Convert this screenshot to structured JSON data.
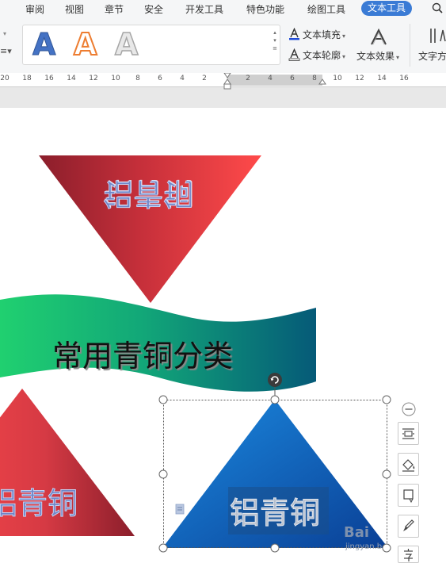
{
  "menubar": {
    "items": [
      {
        "label": "审阅"
      },
      {
        "label": "视图"
      },
      {
        "label": "章节"
      },
      {
        "label": "安全"
      },
      {
        "label": "开发工具"
      },
      {
        "label": "特色功能"
      },
      {
        "label": "绘图工具"
      },
      {
        "label": "文本工具"
      }
    ],
    "active_index": 7,
    "active_color": "#3a7bd5"
  },
  "ribbon": {
    "style_gallery": [
      "A",
      "A",
      "A"
    ],
    "text_fill_label": "文本填充",
    "text_outline_label": "文本轮廓",
    "text_effect_label": "文本效果",
    "text_direction_label": "文字方"
  },
  "ruler": {
    "ticks": [
      "20",
      "18",
      "16",
      "14",
      "12",
      "10",
      "8",
      "6",
      "4",
      "2",
      "2",
      "4",
      "6",
      "8",
      "10",
      "12",
      "14",
      "16"
    ]
  },
  "document": {
    "title_text": "常用青铜分类",
    "flipped_triangle_text": "铝青铜",
    "left_triangle_text": "铝青铜",
    "selected_triangle_text": "铝青铜",
    "colors": {
      "red_gradient_start": "#8b1e2b",
      "red_gradient_end": "#ff4a4a",
      "banner_gradient_start": "#20d070",
      "banner_gradient_end": "#055a78",
      "blue_gradient_start": "#1b8ae0",
      "blue_gradient_end": "#0a3f95"
    }
  },
  "watermark": {
    "brand": "Bai",
    "sub": "jingyan.b"
  }
}
